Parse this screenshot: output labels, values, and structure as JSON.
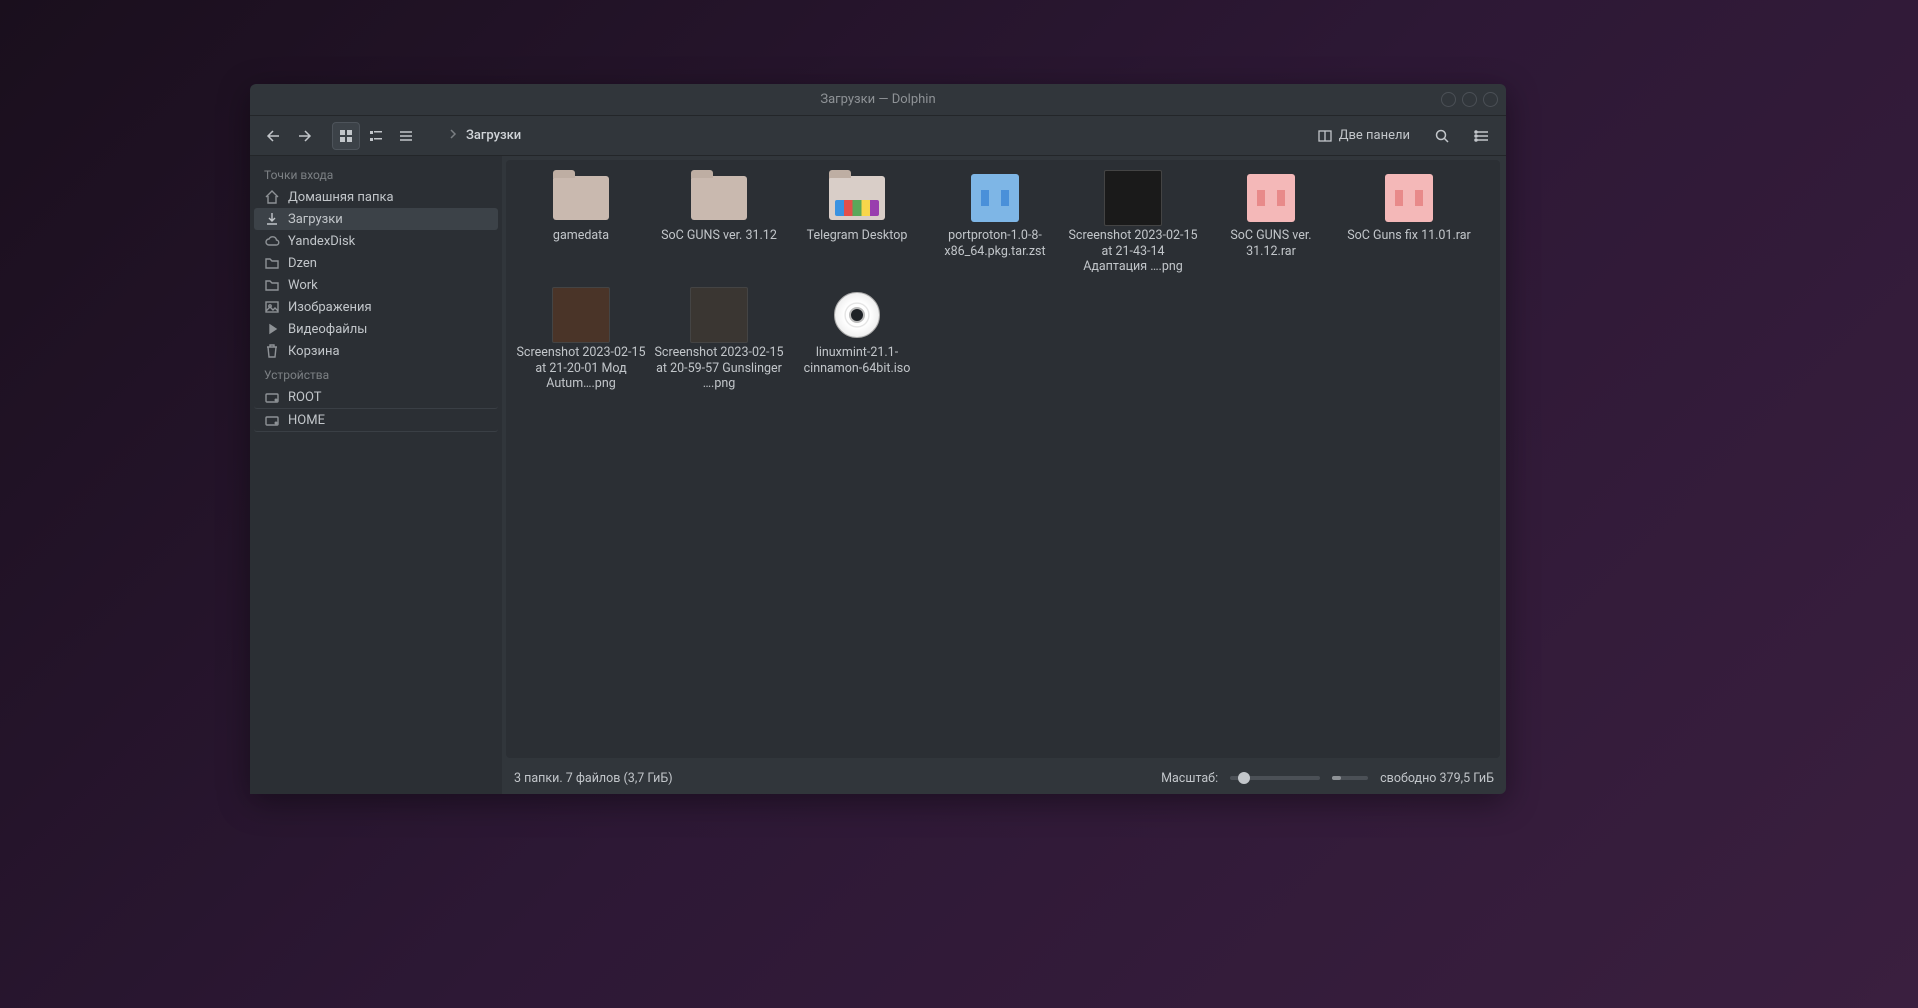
{
  "title": "Загрузки — Dolphin",
  "toolbar": {
    "breadcrumb": "Загрузки",
    "two_panes_label": "Две панели"
  },
  "sidebar": {
    "places_header": "Точки входа",
    "devices_header": "Устройства",
    "places": [
      {
        "label": "Домашняя папка",
        "icon": "home"
      },
      {
        "label": "Загрузки",
        "icon": "download",
        "active": true
      },
      {
        "label": "YandexDisk",
        "icon": "cloud"
      },
      {
        "label": "Dzen",
        "icon": "folder"
      },
      {
        "label": "Work",
        "icon": "folder"
      },
      {
        "label": "Изображения",
        "icon": "image"
      },
      {
        "label": "Видеофайлы",
        "icon": "video"
      },
      {
        "label": "Корзина",
        "icon": "trash"
      }
    ],
    "devices": [
      {
        "label": "ROOT",
        "icon": "drive"
      },
      {
        "label": "HOME",
        "icon": "drive"
      }
    ]
  },
  "files": [
    {
      "name": "gamedata",
      "kind": "folder"
    },
    {
      "name": "SoC GUNS ver. 31.12",
      "kind": "folder"
    },
    {
      "name": "Telegram Desktop",
      "kind": "folder-telegram"
    },
    {
      "name": "portproton-1.0-8-x86_64.pkg.tar.zst",
      "kind": "archive-blue"
    },
    {
      "name": "Screenshot 2023-02-15 at 21-43-14 Адаптация ….png",
      "kind": "screenshot-dark"
    },
    {
      "name": "SoC GUNS ver. 31.12.rar",
      "kind": "archive-pink"
    },
    {
      "name": "SoC Guns fix 11.01.rar",
      "kind": "archive-pink"
    },
    {
      "name": "Screenshot 2023-02-15 at 21-20-01 Мод Autum….png",
      "kind": "screenshot-brown"
    },
    {
      "name": "Screenshot 2023-02-15 at 20-59-57 Gunslinger ….png",
      "kind": "screenshot-light"
    },
    {
      "name": "linuxmint-21.1-cinnamon-64bit.iso",
      "kind": "disc"
    }
  ],
  "status": {
    "summary": "3 папки. 7 файлов (3,7 ГиБ)",
    "zoom_label": "Масштаб:",
    "free_space": "свободно 379,5 ГиБ"
  }
}
